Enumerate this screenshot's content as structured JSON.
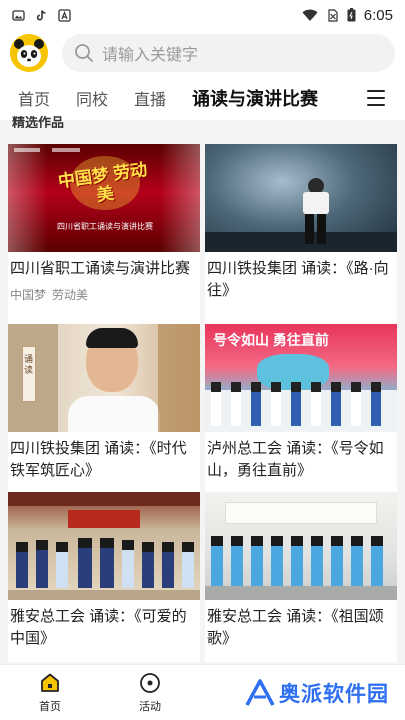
{
  "status_bar": {
    "time": "6:05",
    "icons": [
      "gallery-icon",
      "tiktok-icon",
      "a-app-icon",
      "wifi-icon",
      "no-sim-icon",
      "battery-icon"
    ]
  },
  "header": {
    "search_placeholder": "请输入关键字",
    "avatar_icon": "panda-icon"
  },
  "tabs": [
    {
      "label": "首页",
      "active": false
    },
    {
      "label": "同校",
      "active": false
    },
    {
      "label": "直播",
      "active": false
    },
    {
      "label": "诵读与演讲比赛",
      "active": true
    }
  ],
  "section": {
    "title": "精选作品"
  },
  "cards": [
    {
      "title": "四川省职工诵读与演讲比赛",
      "tags": [
        "中国梦",
        "劳动美"
      ],
      "thumb_text": "中国梦 劳动美",
      "thumb_sub": "四川省职工诵读与演讲比赛"
    },
    {
      "title": "四川铁投集团 诵读：《路·向往》",
      "tags": []
    },
    {
      "title": "四川铁投集团 诵读：《时代铁军筑匠心》",
      "tags": [],
      "thumb_text": "诵读"
    },
    {
      "title": "泸州总工会 诵读：《号令如山，勇往直前》",
      "tags": [],
      "thumb_text": "号令如山  勇往直前"
    },
    {
      "title": "雅安总工会 诵读：《可爱的中国》",
      "tags": []
    },
    {
      "title": "雅安总工会 诵读：《祖国颂歌》",
      "tags": []
    }
  ],
  "bottom_nav": [
    {
      "label": "首页",
      "icon": "home-icon",
      "active": true
    },
    {
      "label": "活动",
      "icon": "activity-icon",
      "active": false
    }
  ],
  "brand": {
    "text": "奥派软件园",
    "logo": "a-logo-icon"
  },
  "colors": {
    "accent": "#f7c500",
    "brand": "#2f6ff2"
  }
}
